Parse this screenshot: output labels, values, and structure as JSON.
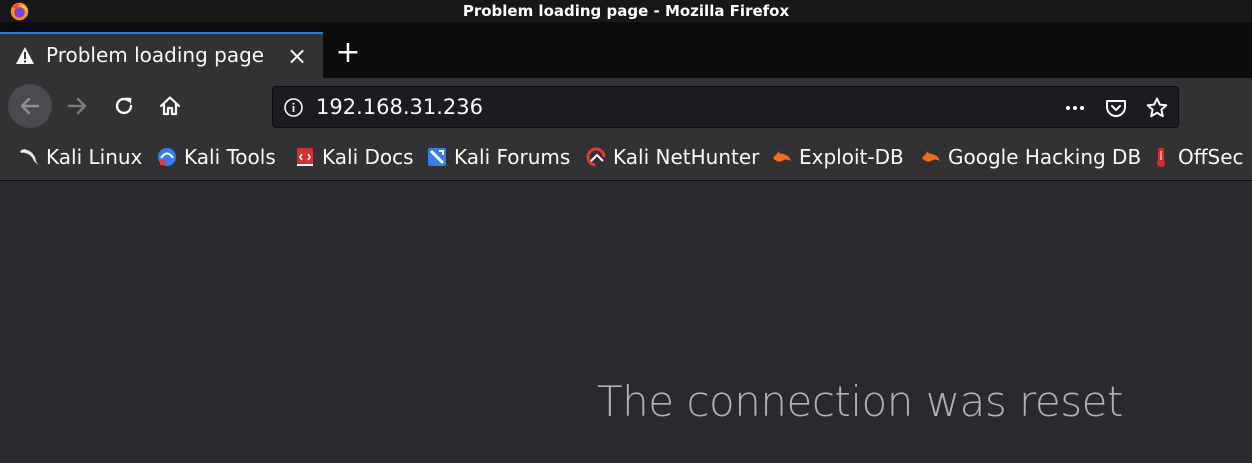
{
  "window": {
    "title": "Problem loading page - Mozilla Firefox"
  },
  "tab": {
    "label": "Problem loading page",
    "close_glyph": "×",
    "icon": "warning-icon"
  },
  "newtab": {
    "glyph": "+"
  },
  "navbar": {
    "url": "192.168.31.236"
  },
  "bookmarks": [
    {
      "label": "Kali Linux",
      "icon": "kali-dragon-icon"
    },
    {
      "label": "Kali Tools",
      "icon": "kali-tools-icon"
    },
    {
      "label": "Kali Docs",
      "icon": "kali-docs-icon"
    },
    {
      "label": "Kali Forums",
      "icon": "kali-forums-icon"
    },
    {
      "label": "Kali NetHunter",
      "icon": "kali-nethunter-icon"
    },
    {
      "label": "Exploit-DB",
      "icon": "exploit-db-icon"
    },
    {
      "label": "Google Hacking DB",
      "icon": "ghdb-icon"
    },
    {
      "label": "OffSec",
      "icon": "offsec-icon"
    }
  ],
  "content": {
    "error_title": "The connection was reset"
  },
  "colors": {
    "accent": "#0a84ff",
    "toolbar": "#323234",
    "background": "#2a2a2e",
    "titlebar": "#17171a"
  }
}
